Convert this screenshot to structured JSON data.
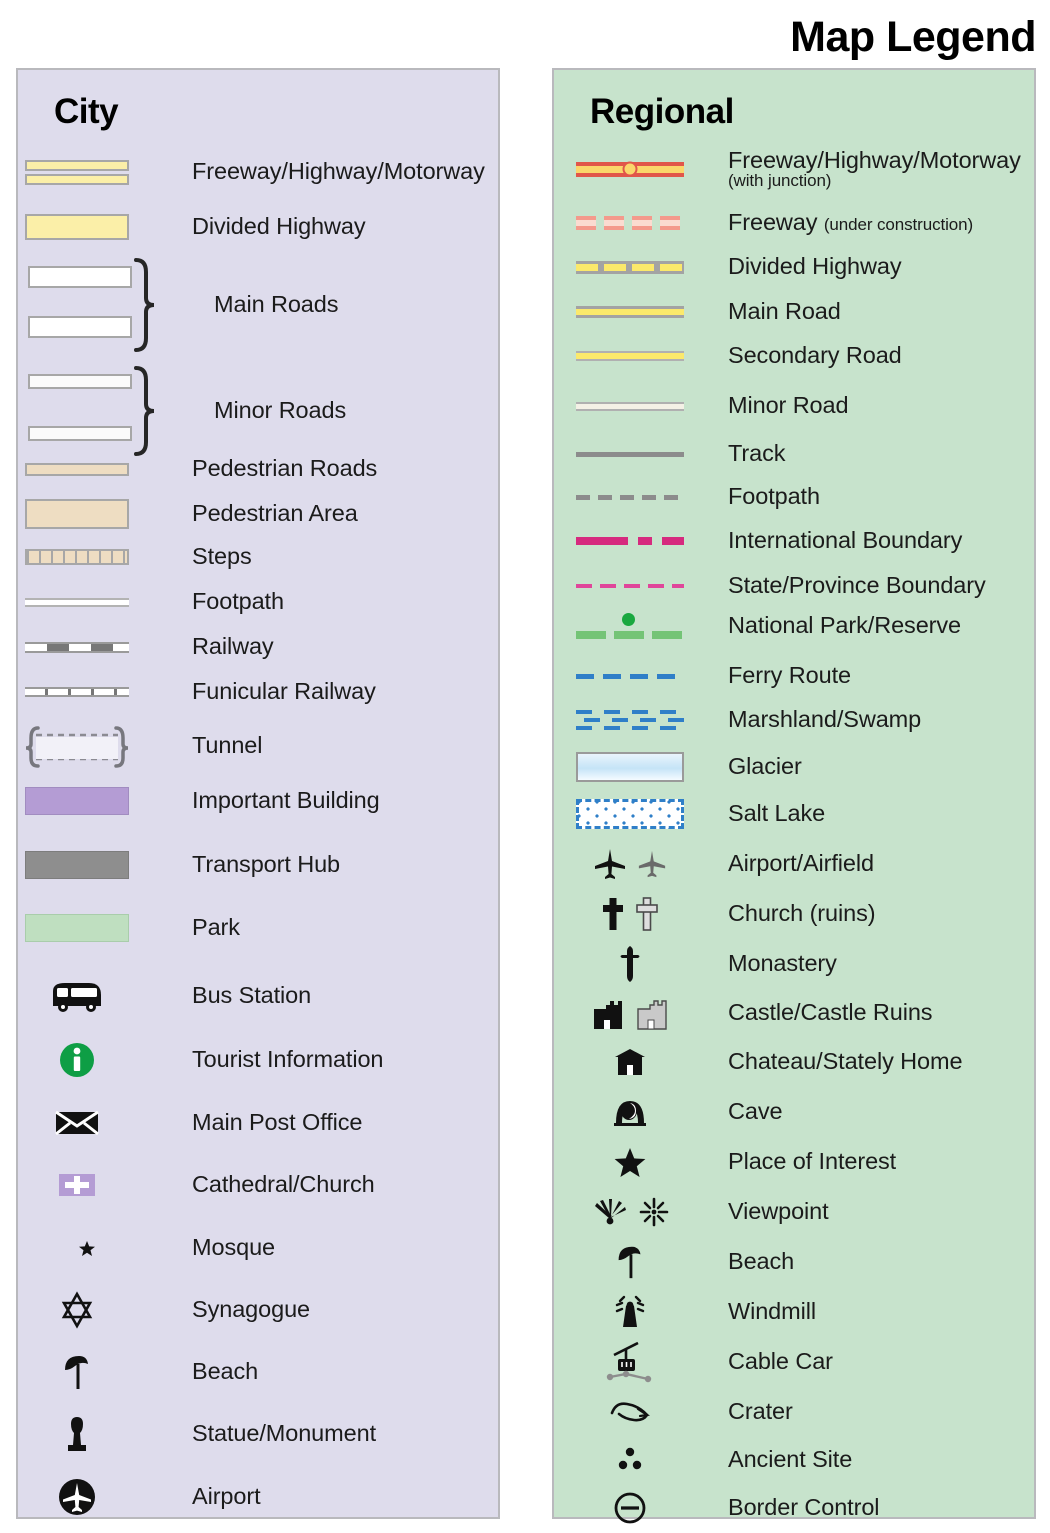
{
  "title": "Map Legend",
  "city": {
    "heading": "City",
    "bg_color": "#dedcec",
    "items": [
      {
        "label": "Freeway/Highway/Motorway",
        "symbol": "freeway-double-bar"
      },
      {
        "label": "Divided Highway",
        "symbol": "divided-highway-bar"
      },
      {
        "label": "Main Roads",
        "symbol": "main-roads-braced-pair"
      },
      {
        "label": "Minor Roads",
        "symbol": "minor-roads-braced-pair"
      },
      {
        "label": "Pedestrian Roads",
        "symbol": "pedestrian-road-bar"
      },
      {
        "label": "Pedestrian Area",
        "symbol": "pedestrian-area-swatch"
      },
      {
        "label": "Steps",
        "symbol": "steps-hatched-bar"
      },
      {
        "label": "Footpath",
        "symbol": "footpath-thin-line"
      },
      {
        "label": "Railway",
        "symbol": "railway-dashed-bar"
      },
      {
        "label": "Funicular Railway",
        "symbol": "funicular-ticked-line"
      },
      {
        "label": "Tunnel",
        "symbol": "tunnel-bracket-dashed"
      },
      {
        "label": "Important Building",
        "symbol": "important-building-swatch"
      },
      {
        "label": "Transport Hub",
        "symbol": "transport-hub-swatch"
      },
      {
        "label": "Park",
        "symbol": "park-swatch"
      },
      {
        "label": "Bus Station",
        "symbol": "bus-icon"
      },
      {
        "label": "Tourist Information",
        "symbol": "information-circle-icon"
      },
      {
        "label": "Main Post Office",
        "symbol": "envelope-icon"
      },
      {
        "label": "Cathedral/Church",
        "symbol": "church-cross-icon"
      },
      {
        "label": "Mosque",
        "symbol": "crescent-star-icon"
      },
      {
        "label": "Synagogue",
        "symbol": "star-of-david-icon"
      },
      {
        "label": "Beach",
        "symbol": "parasol-icon"
      },
      {
        "label": "Statue/Monument",
        "symbol": "statue-icon"
      },
      {
        "label": "Airport",
        "symbol": "airport-circle-icon"
      }
    ]
  },
  "regional": {
    "heading": "Regional",
    "bg_color": "#c7e3cc",
    "items": [
      {
        "label": "Freeway/Highway/Motorway",
        "sublabel": "(with junction)",
        "sub_style": "block",
        "symbol": "freeway-junction-line"
      },
      {
        "label": "Freeway",
        "sublabel": "(under construction)",
        "sub_style": "inline",
        "symbol": "freeway-under-construction-line"
      },
      {
        "label": "Divided Highway",
        "symbol": "divided-highway-line"
      },
      {
        "label": "Main Road",
        "symbol": "main-road-line"
      },
      {
        "label": "Secondary Road",
        "symbol": "secondary-road-line"
      },
      {
        "label": "Minor Road",
        "symbol": "minor-road-line"
      },
      {
        "label": "Track",
        "symbol": "track-line"
      },
      {
        "label": "Footpath",
        "symbol": "footpath-dashed-line"
      },
      {
        "label": "International Boundary",
        "symbol": "international-boundary-line"
      },
      {
        "label": "State/Province Boundary",
        "symbol": "state-boundary-line"
      },
      {
        "label": "National Park/Reserve",
        "symbol": "national-park-line"
      },
      {
        "label": "Ferry Route",
        "symbol": "ferry-route-line"
      },
      {
        "label": "Marshland/Swamp",
        "symbol": "marshland-pattern"
      },
      {
        "label": "Glacier",
        "symbol": "glacier-swatch"
      },
      {
        "label": "Salt Lake",
        "symbol": "salt-lake-swatch"
      },
      {
        "label": "Airport/Airfield",
        "symbol": "airplane-pair-icon"
      },
      {
        "label": "Church (ruins)",
        "symbol": "cross-pair-icon"
      },
      {
        "label": "Monastery",
        "symbol": "ornate-cross-icon"
      },
      {
        "label": "Castle/Castle Ruins",
        "symbol": "castle-pair-icon"
      },
      {
        "label": "Chateau/Stately Home",
        "symbol": "chateau-icon"
      },
      {
        "label": "Cave",
        "symbol": "cave-icon"
      },
      {
        "label": "Place of Interest",
        "symbol": "star-icon"
      },
      {
        "label": "Viewpoint",
        "symbol": "viewpoint-pair-icon"
      },
      {
        "label": "Beach",
        "symbol": "parasol-icon"
      },
      {
        "label": "Windmill",
        "symbol": "windmill-icon"
      },
      {
        "label": "Cable Car",
        "symbol": "cable-car-icon"
      },
      {
        "label": "Crater",
        "symbol": "crater-icon"
      },
      {
        "label": "Ancient Site",
        "symbol": "ancient-site-dots-icon"
      },
      {
        "label": "Border Control",
        "symbol": "border-control-icon"
      }
    ]
  }
}
